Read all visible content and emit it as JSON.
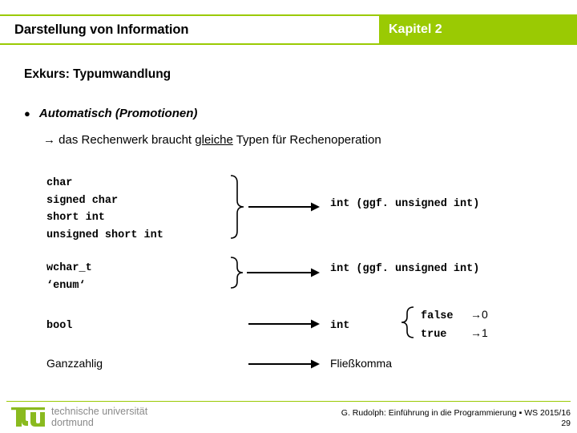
{
  "header": {
    "title": "Darstellung von Information",
    "chapter": "Kapitel 2",
    "accent_color": "#9aca03"
  },
  "slide": {
    "subtitle": "Exkurs: Typumwandlung",
    "bullet": {
      "marker": "bullet-dot",
      "text": "Automatisch (Promotionen)"
    },
    "note": {
      "arrow": "→",
      "before": " das Rechenwerk braucht ",
      "underlined": "gleiche",
      "after": " Typen für Rechenoperation"
    }
  },
  "conversions": {
    "group1": {
      "sources": [
        "char",
        "signed char",
        "short int",
        "unsigned short int"
      ],
      "brace": "}",
      "arrow": "→",
      "target": "int (ggf. unsigned int)"
    },
    "group2": {
      "sources": [
        "wchar_t",
        "‘enum‘"
      ],
      "brace": "}",
      "arrow": "→",
      "target": "int (ggf. unsigned int)"
    },
    "group3": {
      "sources": [
        "bool"
      ],
      "arrow": "→",
      "target": "int",
      "brace": "{",
      "values": [
        {
          "name": "false",
          "arrow": "→",
          "value": "0"
        },
        {
          "name": "true",
          "arrow": "→",
          "value": "1"
        }
      ]
    },
    "group4": {
      "sources": [
        "Ganzzahlig"
      ],
      "arrow": "→",
      "target": "Fließkomma"
    }
  },
  "footer": {
    "logo_mark": "tu",
    "logo_line1": "technische universität",
    "logo_line2": "dortmund",
    "credit": "G. Rudolph: Einführung in die Programmierung ▪ WS 2015/16",
    "page": "29"
  }
}
